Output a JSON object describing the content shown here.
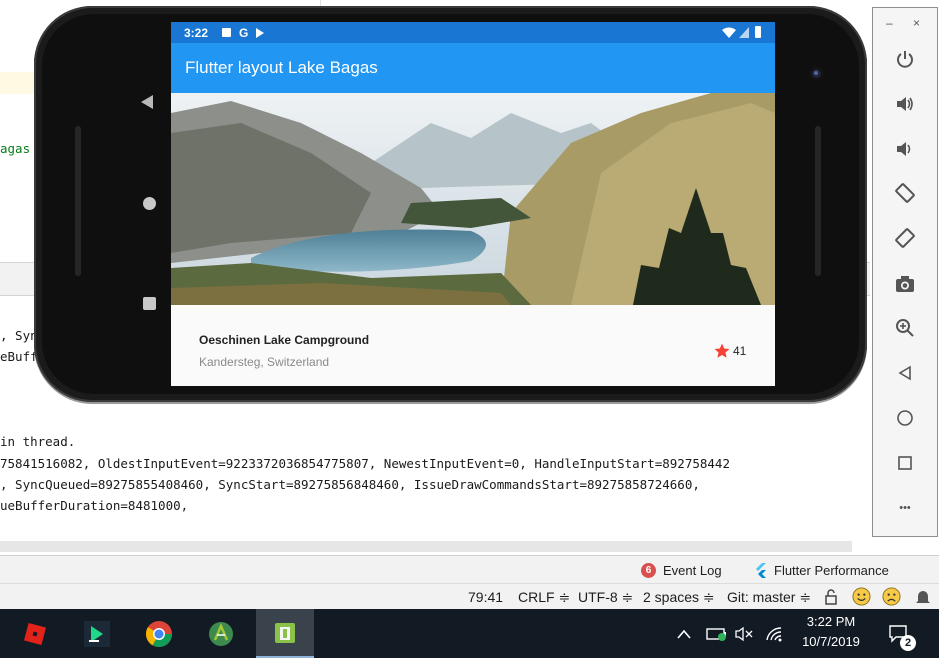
{
  "ide": {
    "code_fragment": "agas",
    "console_lines": [
      ", Syn",
      "eBuff",
      "in thread.",
      "75841516082, OldestInputEvent=9223372036854775807, NewestInputEvent=0, HandleInputStart=892758442",
      ", SyncQueued=89275855408460, SyncStart=89275856848460, IssueDrawCommandsStart=89275858724660,",
      "ueBufferDuration=8481000,"
    ]
  },
  "phone": {
    "status_time": "3:22",
    "status_icons": [
      "a-notification-icon",
      "google-icon",
      "play-icon"
    ],
    "app_title": "Flutter layout Lake Bagas",
    "place_name": "Oeschinen Lake Campground",
    "place_location": "Kandersteg, Switzerland",
    "favorite_count": "41",
    "star_color": "#f44336",
    "appbar_color": "#2196f3",
    "statusbar_color": "#1976d2"
  },
  "emulator_toolbar": {
    "minimize": "–",
    "close": "×",
    "buttons": [
      "power-icon",
      "volume-up-icon",
      "volume-down-icon",
      "rotate-left-icon",
      "rotate-right-icon",
      "camera-icon",
      "zoom-icon",
      "back-icon",
      "home-icon",
      "overview-icon",
      "more-icon"
    ],
    "more_label": "•••"
  },
  "tool_windows": {
    "event_log_count": "6",
    "event_log_label": "Event Log",
    "flutter_perf_label": "Flutter Performance"
  },
  "status_bar": {
    "position": "79:41",
    "line_sep": "CRLF ≑",
    "encoding": "UTF-8 ≑",
    "indent": "2 spaces ≑",
    "git": "Git: master ≑"
  },
  "taskbar": {
    "apps": [
      "roblox-icon",
      "jetbrains-toolbox-icon",
      "chrome-icon",
      "android-studio-icon",
      "emulator-icon"
    ],
    "time": "3:22 PM",
    "date": "10/7/2019",
    "notification_count": "2"
  }
}
